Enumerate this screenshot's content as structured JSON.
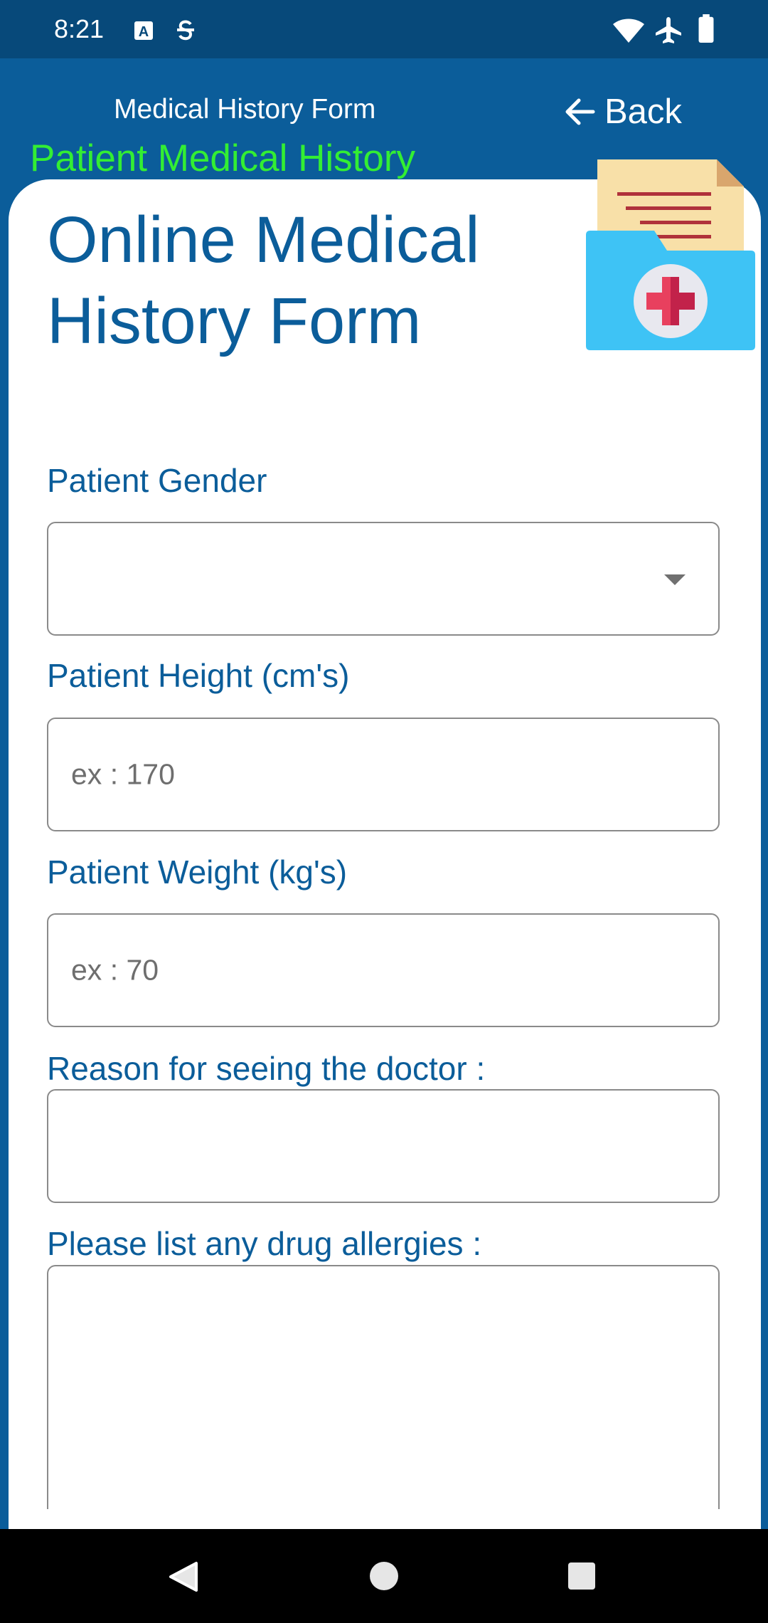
{
  "status_bar": {
    "time": "8:21",
    "left_icons": [
      "a-box-icon",
      "sync-s-icon"
    ],
    "right_icons": [
      "wifi-icon",
      "airplane-icon",
      "battery-icon"
    ]
  },
  "app_bar": {
    "title": "Medical History Form",
    "back_label": "Back",
    "subtitle": "Patient Medical History"
  },
  "form": {
    "title": "Online Medical History Form",
    "gender": {
      "label": "Patient Gender",
      "value": ""
    },
    "height": {
      "label": "Patient Height (cm's)",
      "placeholder": "ex : 170"
    },
    "weight": {
      "label": "Patient Weight  (kg's)",
      "placeholder": "ex : 70"
    },
    "reason": {
      "label": "Reason for seeing the doctor :"
    },
    "allergies": {
      "label": "Please list any drug allergies :"
    }
  },
  "colors": {
    "primary": "#0b5d9a",
    "status_bar": "#07497a",
    "subtitle_green": "#33ee33",
    "folder_blue": "#3ec3f5",
    "cross_red": "#e8405e"
  },
  "nav": {
    "icons": [
      "back-triangle-icon",
      "home-circle-icon",
      "recents-square-icon"
    ]
  }
}
